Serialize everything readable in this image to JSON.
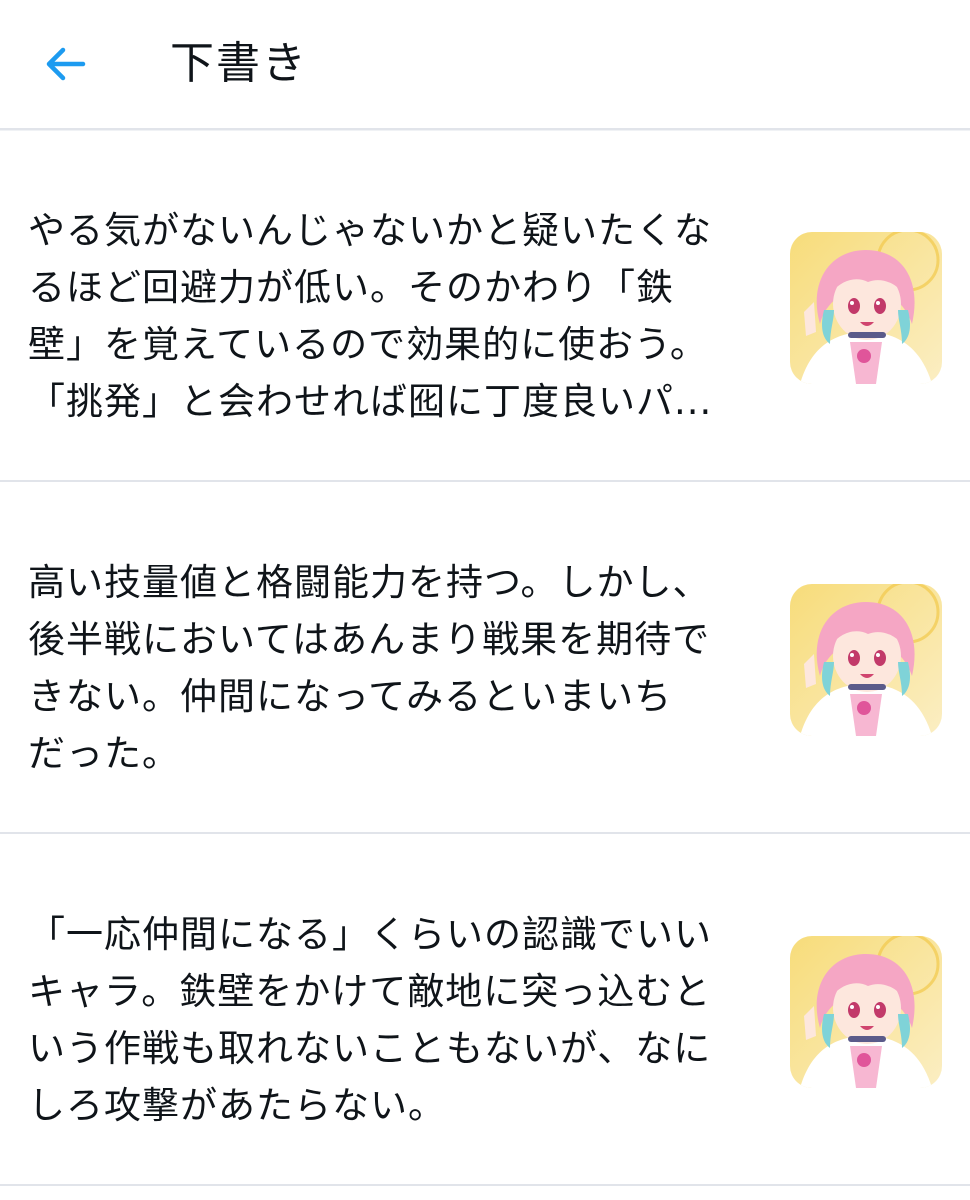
{
  "header": {
    "title": "下書き",
    "back_icon": "arrow-left-icon",
    "accent_color": "#1d9bf0"
  },
  "drafts": [
    {
      "text": "やる気がないんじゃないかと疑いたくな\nるほど回避力が低い。そのかわり「鉄\n壁」を覚えているので効果的に使おう。\n「挑発」と会わせれば囮に丁度良いパ...",
      "attachment_icon": "character-thumbnail"
    },
    {
      "text": "高い技量値と格闘能力を持つ。しかし、\n後半戦においてはあんまり戦果を期待で\nきない。仲間になってみるといまいち\nだった。",
      "attachment_icon": "character-thumbnail"
    },
    {
      "text": "「一応仲間になる」くらいの認識でいい\nキャラ。鉄壁をかけて敵地に突っ込むと\nいう作戦も取れないこともないが、なに\nしろ攻撃があたらない。",
      "attachment_icon": "character-thumbnail"
    }
  ]
}
